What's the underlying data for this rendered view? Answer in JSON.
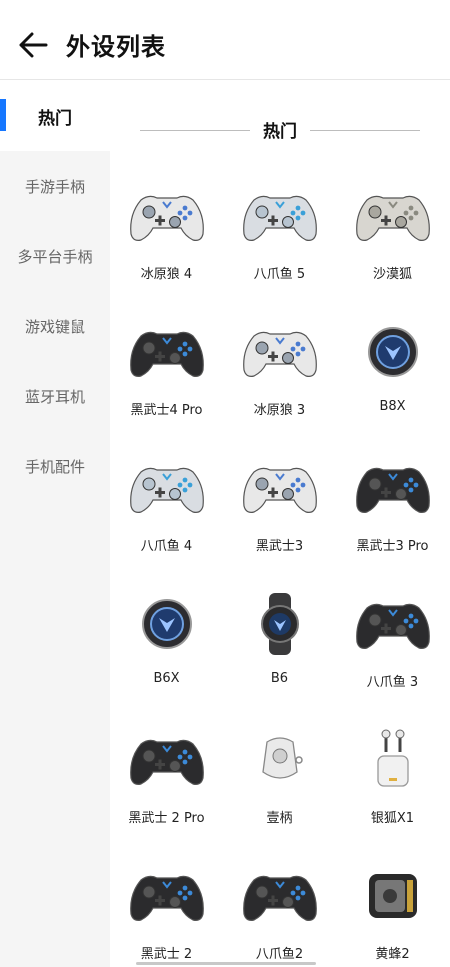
{
  "header": {
    "title": "外设列表",
    "back_icon": "arrow-left-icon"
  },
  "sidebar": {
    "items": [
      {
        "label": "热门",
        "active": true
      },
      {
        "label": "手游手柄",
        "active": false
      },
      {
        "label": "多平台手柄",
        "active": false
      },
      {
        "label": "游戏键鼠",
        "active": false
      },
      {
        "label": "蓝牙耳机",
        "active": false
      },
      {
        "label": "手机配件",
        "active": false
      }
    ],
    "accent_color": "#1677ff"
  },
  "section": {
    "title": "热门"
  },
  "products": [
    {
      "name": "冰原狼 4",
      "icon": "gamepad-white-icon"
    },
    {
      "name": "八爪鱼 5",
      "icon": "gamepad-transparent-icon"
    },
    {
      "name": "沙漠狐",
      "icon": "gamepad-beige-icon"
    },
    {
      "name": "黑武士4 Pro",
      "icon": "gamepad-black-icon"
    },
    {
      "name": "冰原狼 3",
      "icon": "gamepad-white-icon"
    },
    {
      "name": "B8X",
      "icon": "round-controller-icon"
    },
    {
      "name": "八爪鱼 4",
      "icon": "gamepad-transparent-icon"
    },
    {
      "name": "黑武士3",
      "icon": "gamepad-white-icon"
    },
    {
      "name": "黑武士3 Pro",
      "icon": "gamepad-black-icon"
    },
    {
      "name": "B6X",
      "icon": "round-controller-icon"
    },
    {
      "name": "B6",
      "icon": "phone-cooler-icon"
    },
    {
      "name": "八爪鱼 3",
      "icon": "gamepad-black-icon"
    },
    {
      "name": "黑武士 2 Pro",
      "icon": "gamepad-black-icon"
    },
    {
      "name": "壹柄",
      "icon": "mini-controller-icon"
    },
    {
      "name": "银狐X1",
      "icon": "earbuds-icon"
    },
    {
      "name": "黑武士 2",
      "icon": "gamepad-black-icon"
    },
    {
      "name": "八爪鱼2",
      "icon": "gamepad-black-icon"
    },
    {
      "name": "黄蜂2",
      "icon": "phone-grip-icon"
    }
  ]
}
